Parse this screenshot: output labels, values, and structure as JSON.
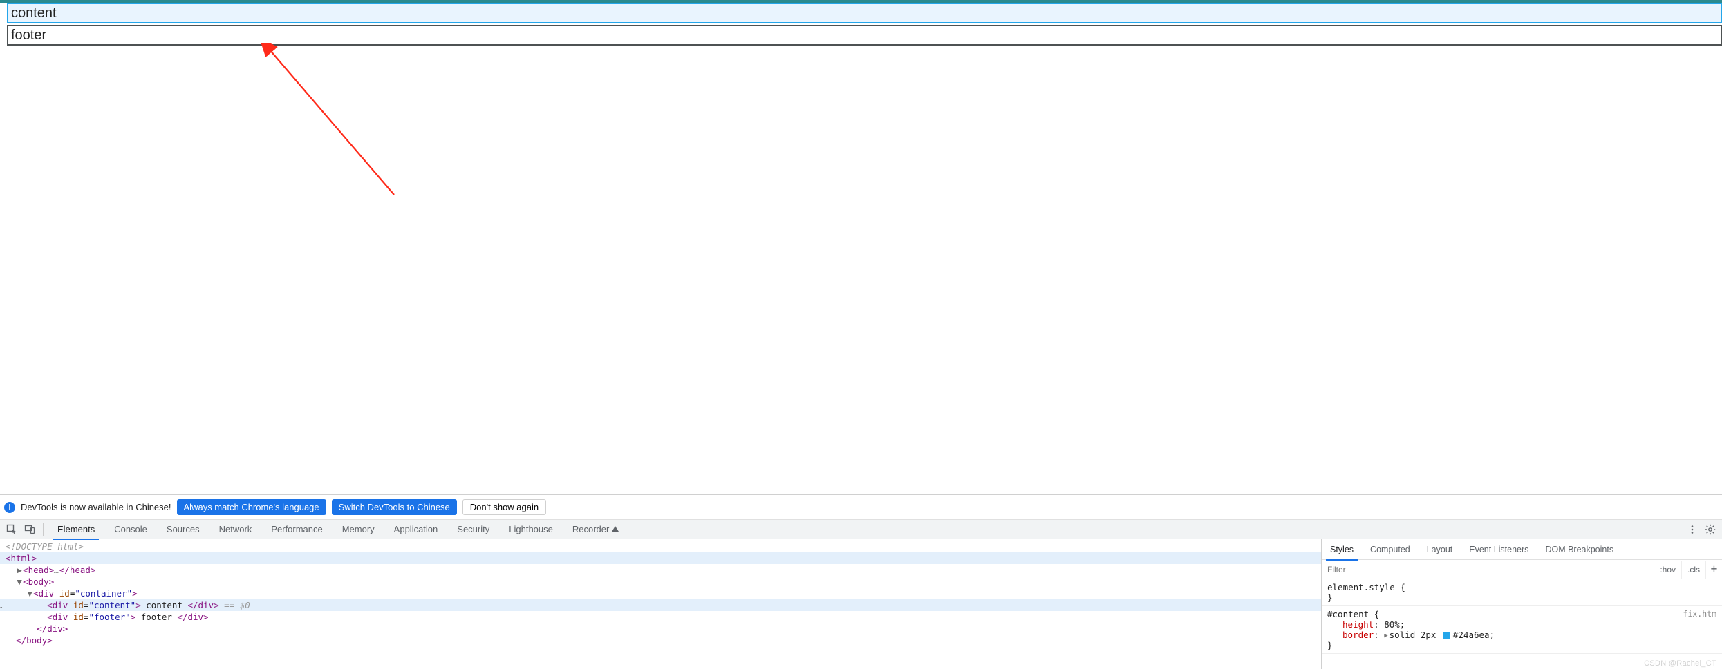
{
  "page": {
    "content_text": "content",
    "footer_text": "footer"
  },
  "devtools": {
    "lang_bar": {
      "message": "DevTools is now available in Chinese!",
      "always_match": "Always match Chrome's language",
      "switch_to": "Switch DevTools to Chinese",
      "dont_show": "Don't show again"
    },
    "tabs": {
      "elements": "Elements",
      "console": "Console",
      "sources": "Sources",
      "network": "Network",
      "performance": "Performance",
      "memory": "Memory",
      "application": "Application",
      "security": "Security",
      "lighthouse": "Lighthouse",
      "recorder": "Recorder"
    },
    "dom": {
      "doctype": "<!DOCTYPE html>",
      "html_open": "html",
      "head_open": "head",
      "head_ellipsis": "…",
      "head_close": "head",
      "body_open": "body",
      "div_container_id": "container",
      "div_content_id": "content",
      "div_content_text": " content ",
      "eq0": " == $0",
      "div_footer_id": "footer",
      "div_footer_text": " footer ",
      "div_close": "div",
      "body_close": "body"
    },
    "styles": {
      "side_tabs": {
        "styles": "Styles",
        "computed": "Computed",
        "layout": "Layout",
        "event_listeners": "Event Listeners",
        "dom_breakpoints": "DOM Breakpoints"
      },
      "filter_placeholder": "Filter",
      "hov": ":hov",
      "cls": ".cls",
      "plus": "+",
      "element_style_sel": "element.style",
      "rule2": {
        "selector": "#content",
        "src": "fix.htm",
        "prop1_name": "height",
        "prop1_val": "80%",
        "prop2_name": "border",
        "prop2_val_a": "solid 2px",
        "prop2_color": "#24a6ea"
      }
    }
  },
  "watermark": "CSDN @Rachel_CT"
}
